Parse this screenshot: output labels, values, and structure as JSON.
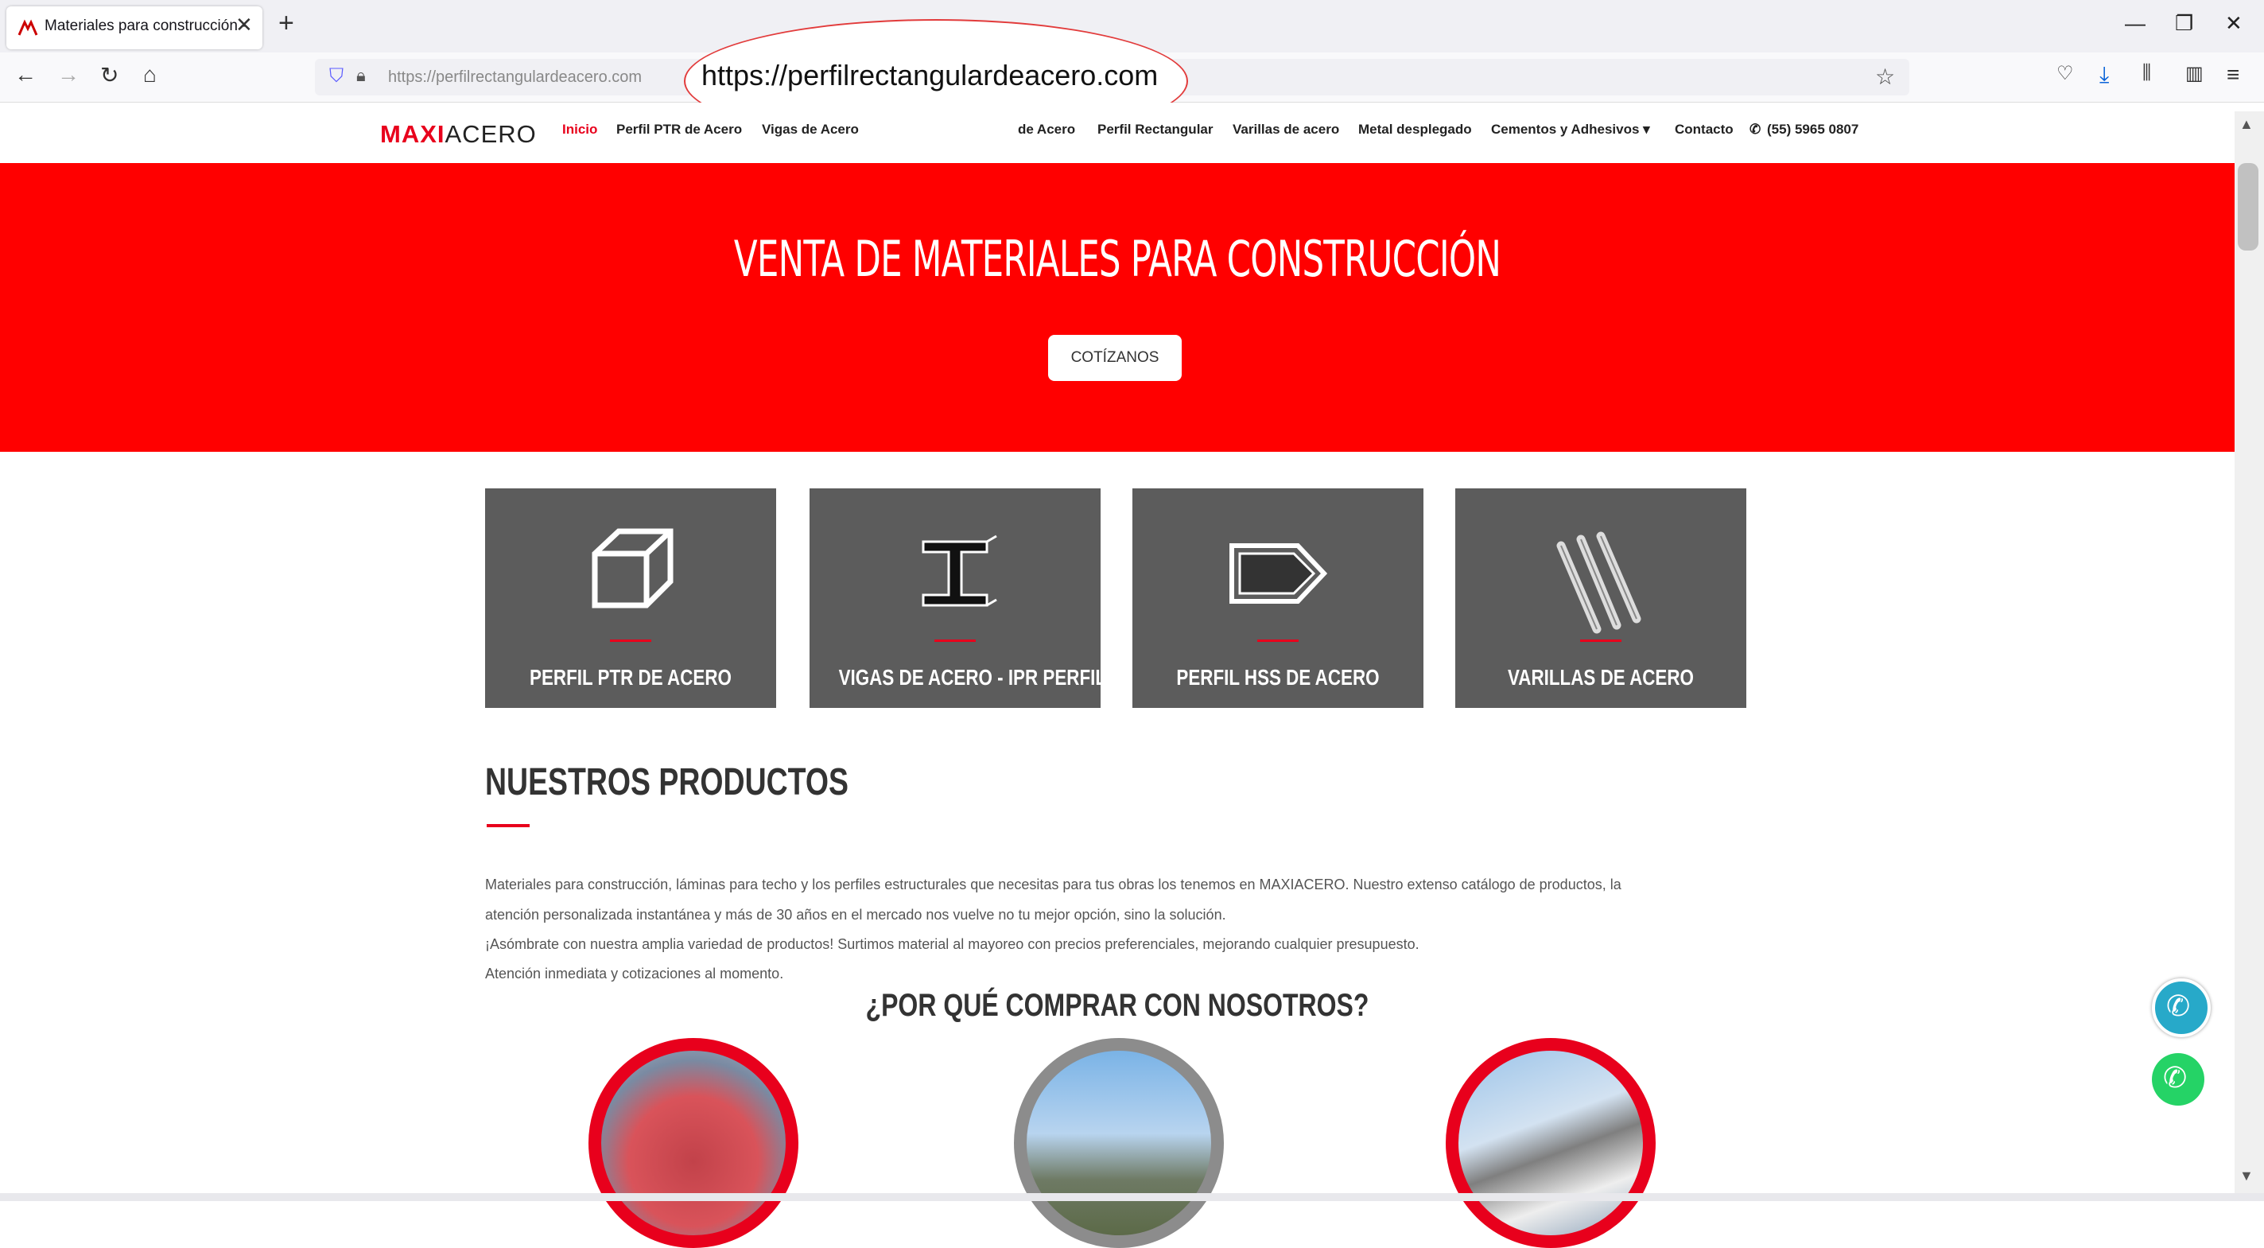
{
  "browser": {
    "tab_title": "Materiales para construcción -",
    "tab_close": "✕",
    "new_tab": "+",
    "url": "https://perfilrectangulardeacero.com",
    "url_callout": "https://perfilrectangulardeacero.com"
  },
  "site": {
    "logo_maxi": "MAXI",
    "logo_acero": "ACERO",
    "menu": [
      "Inicio",
      "Perfil PTR de Acero",
      "Vigas de Acero",
      "de Acero",
      "Perfil Rectangular",
      "Varillas de acero",
      "Metal desplegado",
      "Cementos y Adhesivos ▾",
      "Contacto",
      "(55) 5965 0807"
    ],
    "accent": "#e8001c"
  },
  "hero": {
    "title": "VENTA DE MATERIALES PARA CONSTRUCCIÓN",
    "button": "COTÍZANOS"
  },
  "cards": [
    {
      "label": "PERFIL PTR DE ACERO",
      "icon": "cube-icon"
    },
    {
      "label": "VIGAS DE ACERO - IPR PERFIL",
      "icon": "i-beam-icon"
    },
    {
      "label": "PERFIL HSS DE ACERO",
      "icon": "hss-profile-icon"
    },
    {
      "label": "VARILLAS DE ACERO",
      "icon": "rebar-icon"
    }
  ],
  "products": {
    "title": "NUESTROS PRODUCTOS",
    "lines": [
      "Materiales para construcción, láminas para techo y los perfiles estructurales que necesitas para tus obras los tenemos en MAXIACERO. Nuestro extenso catálogo de productos, la",
      "atención personalizada instantánea y más de 30 años en el mercado nos vuelve no tu mejor opción, sino la solución.",
      "¡Asómbrate con nuestra amplia variedad de productos! Surtimos material al mayoreo con precios preferenciales, mejorando cualquier presupuesto.",
      "Atención inmediata y cotizaciones al momento."
    ]
  },
  "why": {
    "title": "¿POR QUÉ COMPRAR CON NOSOTROS?"
  }
}
